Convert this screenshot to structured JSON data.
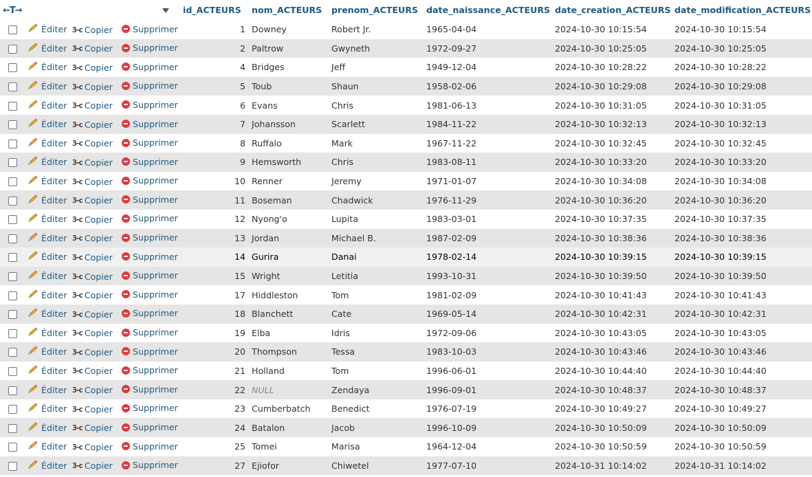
{
  "header": {
    "nav_arrows": "←T→",
    "columns": [
      "id_ACTEURS",
      "nom_ACTEURS",
      "prenom_ACTEURS",
      "date_naissance_ACTEURS",
      "date_creation_ACTEURS",
      "date_modification_ACTEURS"
    ]
  },
  "actions": {
    "edit": "Éditer",
    "copy": "Copier",
    "delete": "Supprimer"
  },
  "rows": [
    {
      "id": "1",
      "nom": "Downey",
      "prenom": "Robert Jr.",
      "naissance": "1965-04-04",
      "creation": "2024-10-30 10:15:54",
      "modification": "2024-10-30 10:15:54"
    },
    {
      "id": "2",
      "nom": "Paltrow",
      "prenom": "Gwyneth",
      "naissance": "1972-09-27",
      "creation": "2024-10-30 10:25:05",
      "modification": "2024-10-30 10:25:05"
    },
    {
      "id": "4",
      "nom": "Bridges",
      "prenom": "Jeff",
      "naissance": "1949-12-04",
      "creation": "2024-10-30 10:28:22",
      "modification": "2024-10-30 10:28:22"
    },
    {
      "id": "5",
      "nom": "Toub",
      "prenom": "Shaun",
      "naissance": "1958-02-06",
      "creation": "2024-10-30 10:29:08",
      "modification": "2024-10-30 10:29:08"
    },
    {
      "id": "6",
      "nom": "Evans",
      "prenom": "Chris",
      "naissance": "1981-06-13",
      "creation": "2024-10-30 10:31:05",
      "modification": "2024-10-30 10:31:05"
    },
    {
      "id": "7",
      "nom": "Johansson",
      "prenom": "Scarlett",
      "naissance": "1984-11-22",
      "creation": "2024-10-30 10:32:13",
      "modification": "2024-10-30 10:32:13"
    },
    {
      "id": "8",
      "nom": "Ruffalo",
      "prenom": "Mark",
      "naissance": "1967-11-22",
      "creation": "2024-10-30 10:32:45",
      "modification": "2024-10-30 10:32:45"
    },
    {
      "id": "9",
      "nom": "Hemsworth",
      "prenom": "Chris",
      "naissance": "1983-08-11",
      "creation": "2024-10-30 10:33:20",
      "modification": "2024-10-30 10:33:20"
    },
    {
      "id": "10",
      "nom": "Renner",
      "prenom": "Jeremy",
      "naissance": "1971-01-07",
      "creation": "2024-10-30 10:34:08",
      "modification": "2024-10-30 10:34:08"
    },
    {
      "id": "11",
      "nom": "Boseman",
      "prenom": "Chadwick",
      "naissance": "1976-11-29",
      "creation": "2024-10-30 10:36:20",
      "modification": "2024-10-30 10:36:20"
    },
    {
      "id": "12",
      "nom": "Nyong'o",
      "prenom": "Lupita",
      "naissance": "1983-03-01",
      "creation": "2024-10-30 10:37:35",
      "modification": "2024-10-30 10:37:35"
    },
    {
      "id": "13",
      "nom": "Jordan",
      "prenom": "Michael B.",
      "naissance": "1987-02-09",
      "creation": "2024-10-30 10:38:36",
      "modification": "2024-10-30 10:38:36"
    },
    {
      "id": "14",
      "nom": "Gurira",
      "prenom": "Danai",
      "naissance": "1978-02-14",
      "creation": "2024-10-30 10:39:15",
      "modification": "2024-10-30 10:39:15"
    },
    {
      "id": "15",
      "nom": "Wright",
      "prenom": "Letitia",
      "naissance": "1993-10-31",
      "creation": "2024-10-30 10:39:50",
      "modification": "2024-10-30 10:39:50"
    },
    {
      "id": "17",
      "nom": "Hiddleston",
      "prenom": "Tom",
      "naissance": "1981-02-09",
      "creation": "2024-10-30 10:41:43",
      "modification": "2024-10-30 10:41:43"
    },
    {
      "id": "18",
      "nom": "Blanchett",
      "prenom": "Cate",
      "naissance": "1969-05-14",
      "creation": "2024-10-30 10:42:31",
      "modification": "2024-10-30 10:42:31"
    },
    {
      "id": "19",
      "nom": "Elba",
      "prenom": "Idris",
      "naissance": "1972-09-06",
      "creation": "2024-10-30 10:43:05",
      "modification": "2024-10-30 10:43:05"
    },
    {
      "id": "20",
      "nom": "Thompson",
      "prenom": "Tessa",
      "naissance": "1983-10-03",
      "creation": "2024-10-30 10:43:46",
      "modification": "2024-10-30 10:43:46"
    },
    {
      "id": "21",
      "nom": "Holland",
      "prenom": "Tom",
      "naissance": "1996-06-01",
      "creation": "2024-10-30 10:44:40",
      "modification": "2024-10-30 10:44:40"
    },
    {
      "id": "22",
      "nom": "NULL",
      "prenom": "Zendaya",
      "naissance": "1996-09-01",
      "creation": "2024-10-30 10:48:37",
      "modification": "2024-10-30 10:48:37"
    },
    {
      "id": "23",
      "nom": "Cumberbatch",
      "prenom": "Benedict",
      "naissance": "1976-07-19",
      "creation": "2024-10-30 10:49:27",
      "modification": "2024-10-30 10:49:27"
    },
    {
      "id": "24",
      "nom": "Batalon",
      "prenom": "Jacob",
      "naissance": "1996-10-09",
      "creation": "2024-10-30 10:50:09",
      "modification": "2024-10-30 10:50:09"
    },
    {
      "id": "25",
      "nom": "Tomei",
      "prenom": "Marisa",
      "naissance": "1964-12-04",
      "creation": "2024-10-30 10:50:59",
      "modification": "2024-10-30 10:50:59"
    },
    {
      "id": "27",
      "nom": "Ejiofor",
      "prenom": "Chiwetel",
      "naissance": "1977-07-10",
      "creation": "2024-10-31 10:14:02",
      "modification": "2024-10-31 10:14:02"
    }
  ]
}
